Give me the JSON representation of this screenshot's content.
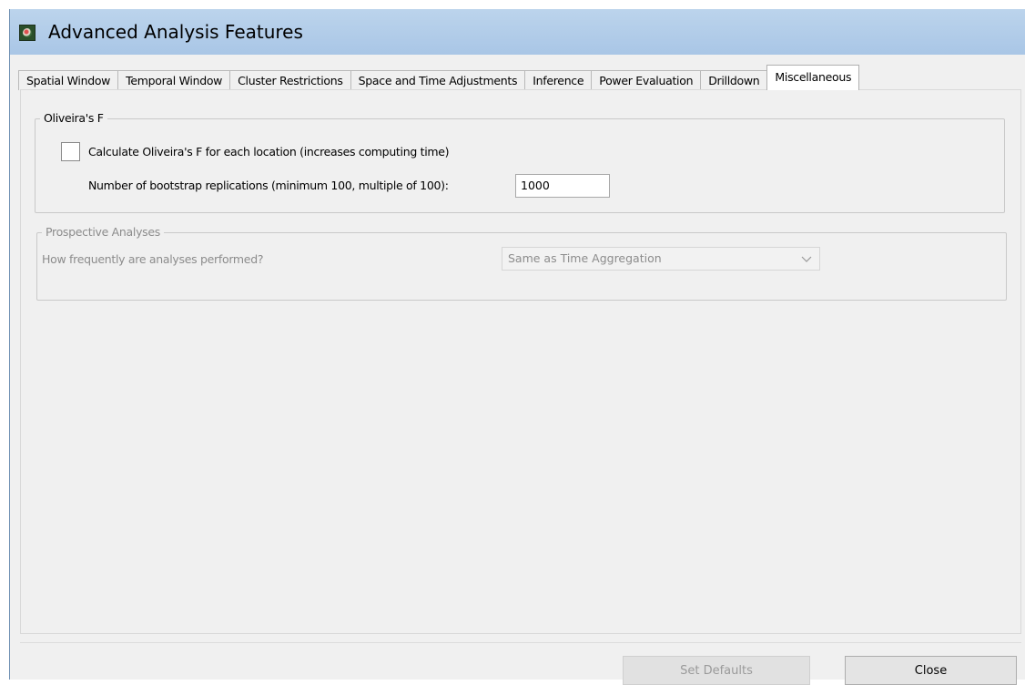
{
  "window": {
    "title": "Advanced Analysis Features",
    "icon": "app-icon"
  },
  "tabs": [
    {
      "label": "Spatial Window",
      "active": false
    },
    {
      "label": "Temporal Window",
      "active": false
    },
    {
      "label": "Cluster Restrictions",
      "active": false
    },
    {
      "label": "Space and Time Adjustments",
      "active": false
    },
    {
      "label": "Inference",
      "active": false
    },
    {
      "label": "Power Evaluation",
      "active": false
    },
    {
      "label": "Drilldown",
      "active": false
    },
    {
      "label": "Miscellaneous",
      "active": true
    }
  ],
  "oliveira": {
    "group_label": "Oliveira's F",
    "checkbox_label": "Calculate Oliveira's F for each location (increases computing time)",
    "checked": false,
    "replications_label": "Number of bootstrap replications (minimum 100, multiple of 100):",
    "replications_value": "1000"
  },
  "prospective": {
    "group_label": "Prospective Analyses",
    "frequency_label": "How frequently are analyses performed?",
    "frequency_selected": "Same as Time Aggregation",
    "enabled": false
  },
  "buttons": {
    "set_defaults": "Set Defaults",
    "close": "Close"
  }
}
